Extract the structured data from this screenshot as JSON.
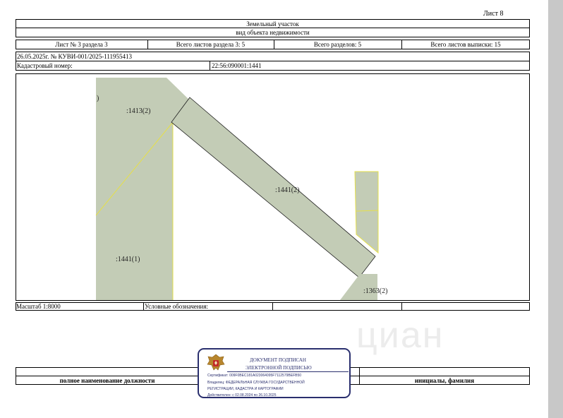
{
  "sheet_label": "Лист 8",
  "header": {
    "title": "Земельный участок",
    "subtitle": "вид объекта недвижимости"
  },
  "info_row": {
    "sheet_section": "Лист № 3 раздела 3",
    "sheets_in_section": "Всего листов раздела 3: 5",
    "total_sections": "Всего разделов: 5",
    "total_sheets": "Всего листов выписки: 15"
  },
  "document_ref": "26.05.2025г. № КУВИ-001/2025-111955413",
  "cadastral": {
    "label": "Кадастровый номер:",
    "value": "22:56:090001:1441"
  },
  "map": {
    "parcel_labels": {
      "p1413": ":1413(2)",
      "p1441_2": ":1441(2)",
      "p1441_1": ":1441(1)",
      "p1363": ":1363(2)",
      "edge_mark": ")"
    },
    "fill_color": "#c3ccb6",
    "boundary_color": "#e6e04a"
  },
  "scale_row": {
    "scale": "Масштаб 1:8000",
    "legend_label": "Условные обозначения:"
  },
  "signature_row": {
    "position_label": "полное наименование должности",
    "initials_label": "инициалы, фамилия"
  },
  "stamp": {
    "line1": "ДОКУМЕНТ ПОДПИСАН",
    "line2": "ЭЛЕКТРОННОЙ ПОДПИСЬЮ",
    "certificate": "Сертификат: 009F0BEC181A023064095F7112579BEFB50",
    "owner_line1": "Владелец: ФЕДЕРАЛЬНАЯ СЛУЖБА ГОСУДАРСТВЕННОЙ",
    "owner_line2": "РЕГИСТРАЦИИ, КАДАСТРА И КАРТОГРАФИИ",
    "validity": "Действителен: с 02.08.2024 по 26.10.2025",
    "color": "#2a2f6e"
  },
  "watermark": "циан"
}
